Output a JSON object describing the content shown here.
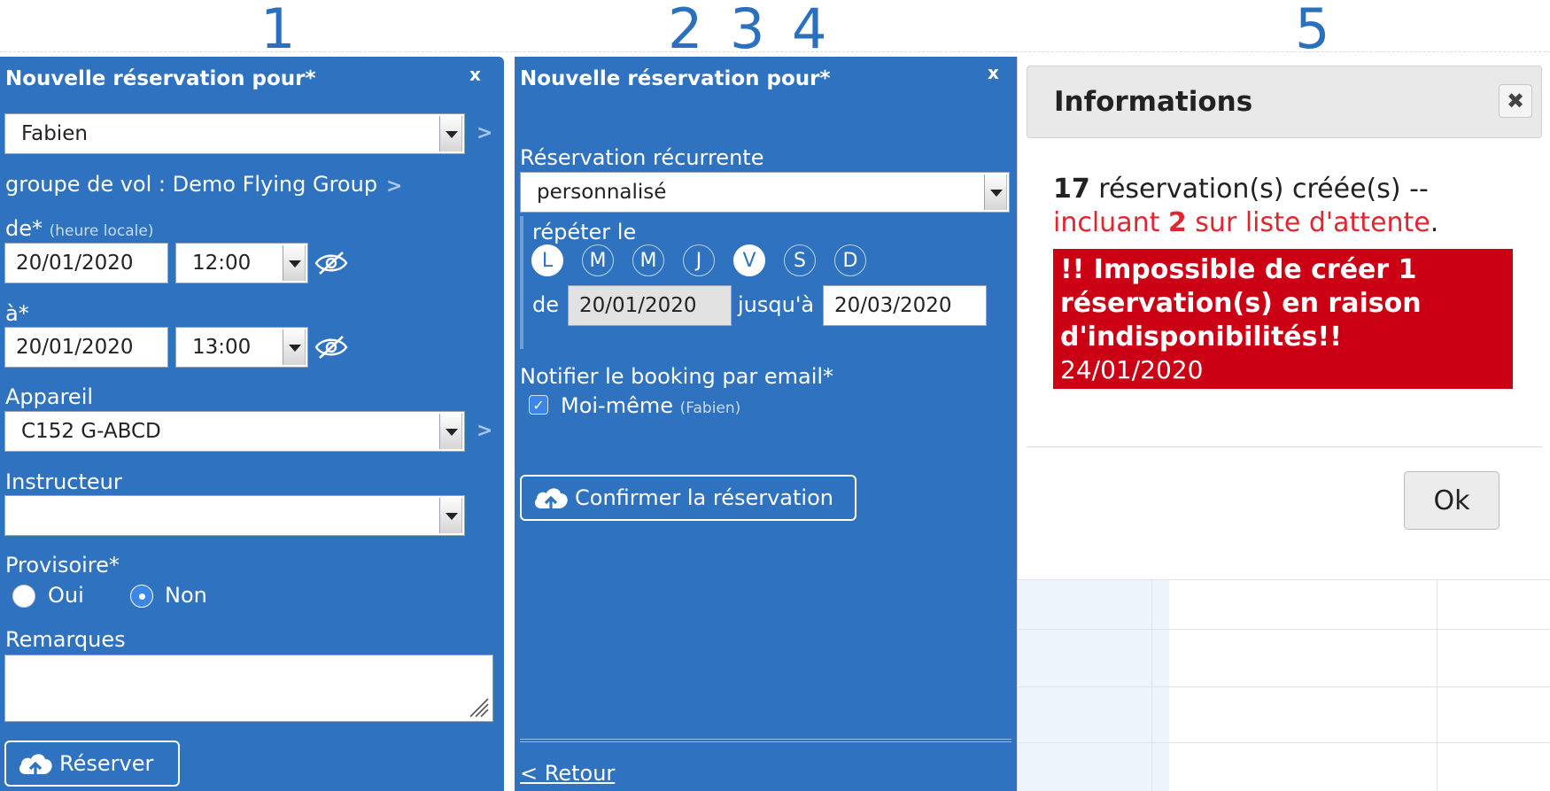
{
  "steps": [
    "1",
    "2",
    "3",
    "4",
    "5"
  ],
  "panel1": {
    "title": "Nouvelle réservation pour*",
    "close": "x",
    "pilot_value": "Fabien",
    "group_text": "groupe de vol : Demo Flying Group",
    "from_label": "de*",
    "from_hint": "(heure locale)",
    "from_date": "20/01/2020",
    "from_time": "12:00",
    "to_label": "à*",
    "to_date": "20/01/2020",
    "to_time": "13:00",
    "aircraft_label": "Appareil",
    "aircraft_value": "C152 G-ABCD",
    "instructor_label": "Instructeur",
    "instructor_value": "",
    "provisional_label": "Provisoire*",
    "opt_yes": "Oui",
    "opt_no": "Non",
    "remarks_label": "Remarques",
    "reserve_button": "Réserver",
    "chevron": ">"
  },
  "panel2": {
    "title": "Nouvelle réservation pour*",
    "close": "x",
    "recurring_label": "Réservation récurrente",
    "recurring_value": "personnalisé",
    "repeat_label": "répéter le",
    "days": [
      {
        "label": "L",
        "selected": true
      },
      {
        "label": "M",
        "selected": false
      },
      {
        "label": "M",
        "selected": false
      },
      {
        "label": "J",
        "selected": false
      },
      {
        "label": "V",
        "selected": true
      },
      {
        "label": "S",
        "selected": false
      },
      {
        "label": "D",
        "selected": false
      }
    ],
    "from_label": "de",
    "from_date": "20/01/2020",
    "until_label": "jusqu'à",
    "until_date": "20/03/2020",
    "notify_label": "Notifier le booking par email*",
    "notify_self": "Moi-même",
    "notify_self_name": "(Fabien)",
    "confirm_button": "Confirmer la réservation",
    "back_link": "< Retour"
  },
  "modal": {
    "title": "Informations",
    "count": "17",
    "created_text": " réservation(s) créée(s) --",
    "waitlist_prefix": "incluant ",
    "waitlist_count": "2",
    "waitlist_suffix": " sur liste d'attente",
    "period": ".",
    "error_line1": "!! Impossible de créer 1",
    "error_line2": "réservation(s) en raison",
    "error_line3": "d'indisponibilités!!",
    "error_date": "24/01/2020",
    "ok_button": "Ok"
  },
  "colors": {
    "panel_blue": "#2f72bf",
    "error_red": "#cc0014",
    "step_blue": "#2b70bf"
  }
}
